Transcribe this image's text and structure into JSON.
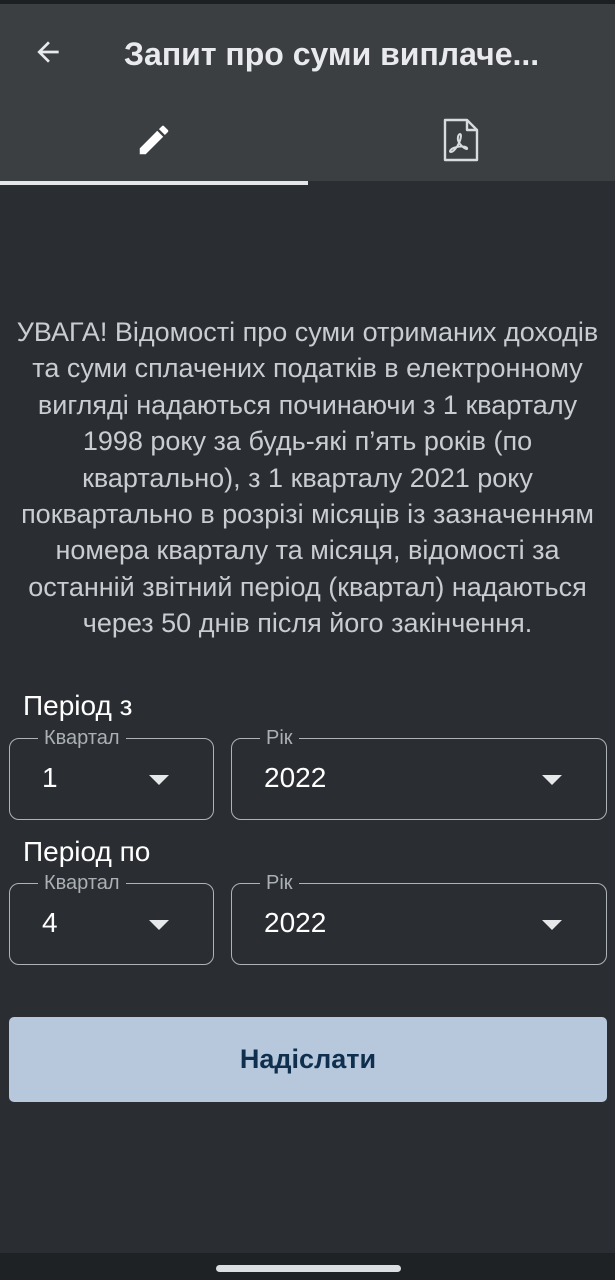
{
  "app_bar": {
    "title": "Запит про суми виплаче...",
    "back_icon": "arrow-left-icon"
  },
  "tabs": [
    {
      "icon": "pencil-icon",
      "selected": true
    },
    {
      "icon": "pdf-file-icon",
      "selected": false
    }
  ],
  "notice": "УВАГА! Відомості про суми отриманих доходів та суми сплачених податків в електронному вигляді надаються починаючи з 1 кварталу 1998 року за будь-які п’ять років (по квартально), з 1 кварталу 2021 року поквартально в розрізі місяців із зазначенням номера кварталу та місяця, відомості за останній звітний період (квартал) надаються через 50 днів після його закінчення.",
  "period_from": {
    "label": "Період з",
    "quarter": {
      "legend": "Квартал",
      "value": "1"
    },
    "year": {
      "legend": "Рік",
      "value": "2022"
    }
  },
  "period_to": {
    "label": "Період по",
    "quarter": {
      "legend": "Квартал",
      "value": "4"
    },
    "year": {
      "legend": "Рік",
      "value": "2022"
    }
  },
  "submit_label": "Надіслати",
  "colors": {
    "background": "#2a2e32",
    "app_bar": "#3b3f42",
    "button": "#b7c7dc",
    "button_text": "#0e2f4d"
  }
}
